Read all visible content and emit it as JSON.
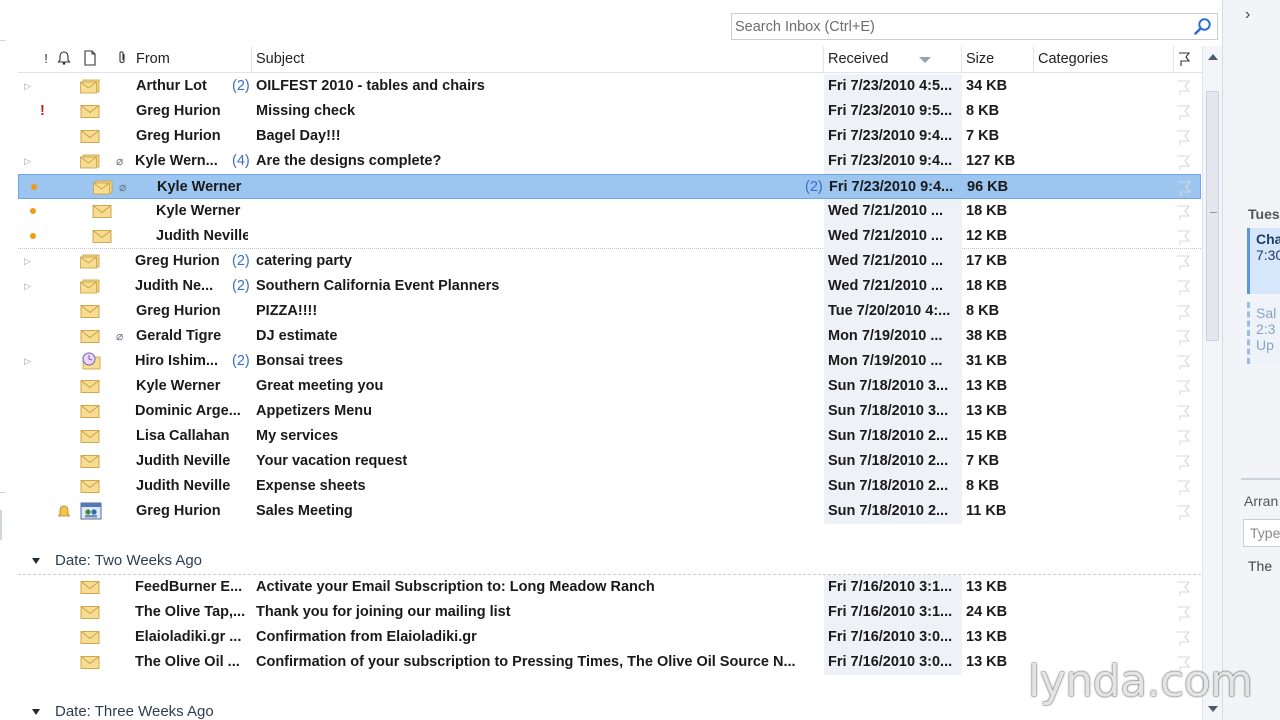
{
  "search": {
    "placeholder": "Search Inbox (Ctrl+E)"
  },
  "columns": {
    "from": "From",
    "subject": "Subject",
    "received": "Received",
    "size": "Size",
    "categories": "Categories"
  },
  "messages": [
    {
      "from": "Arthur Lot",
      "count": "(2)",
      "subject": "OILFEST 2010 - tables and chairs",
      "received": "Fri 7/23/2010 4:5...",
      "size": "34 KB"
    },
    {
      "from": "Greg Hurion",
      "subject": "Missing check",
      "received": "Fri 7/23/2010 9:5...",
      "size": "8 KB",
      "importance": "!"
    },
    {
      "from": "Greg Hurion",
      "subject": "Bagel Day!!!",
      "received": "Fri 7/23/2010 9:4...",
      "size": "7 KB"
    },
    {
      "from": "Kyle Wern...",
      "count": "(4)",
      "subject": "Are the designs complete?",
      "received": "Fri 7/23/2010 9:4...",
      "size": "127 KB"
    },
    {
      "from": "Kyle Werner",
      "count": "(2)",
      "subject": "",
      "received": "Fri 7/23/2010 9:4...",
      "size": "96 KB"
    },
    {
      "from": "Kyle Werner",
      "subject": "",
      "received": "Wed 7/21/2010 ...",
      "size": "18 KB"
    },
    {
      "from": "Judith Neville",
      "subject": "",
      "received": "Wed 7/21/2010 ...",
      "size": "12 KB"
    },
    {
      "from": "Greg Hurion",
      "count": "(2)",
      "subject": "catering party",
      "received": "Wed 7/21/2010 ...",
      "size": "17 KB"
    },
    {
      "from": "Judith Ne...",
      "count": "(2)",
      "subject": "Southern California Event Planners",
      "received": "Wed 7/21/2010 ...",
      "size": "18 KB"
    },
    {
      "from": "Greg Hurion",
      "subject": "PIZZA!!!!",
      "received": "Tue 7/20/2010 4:...",
      "size": "8 KB"
    },
    {
      "from": "Gerald Tigre",
      "subject": "DJ estimate",
      "received": "Mon 7/19/2010 ...",
      "size": "38 KB"
    },
    {
      "from": "Hiro Ishim...",
      "count": "(2)",
      "subject": "Bonsai trees",
      "received": "Mon 7/19/2010 ...",
      "size": "31 KB"
    },
    {
      "from": "Kyle Werner",
      "subject": "Great meeting you",
      "received": "Sun 7/18/2010 3...",
      "size": "13 KB"
    },
    {
      "from": "Dominic Arge...",
      "subject": "Appetizers Menu",
      "received": "Sun 7/18/2010 3...",
      "size": "13 KB"
    },
    {
      "from": "Lisa Callahan",
      "subject": "My services",
      "received": "Sun 7/18/2010 2...",
      "size": "15 KB"
    },
    {
      "from": "Judith Neville",
      "subject": "Your vacation request",
      "received": "Sun 7/18/2010 2...",
      "size": "7 KB"
    },
    {
      "from": "Judith Neville",
      "subject": "Expense sheets",
      "received": "Sun 7/18/2010 2...",
      "size": "8 KB"
    },
    {
      "from": "Greg Hurion",
      "subject": "Sales Meeting",
      "received": "Sun 7/18/2010 2...",
      "size": "11 KB"
    }
  ],
  "group_two_weeks": {
    "label": "Date: Two Weeks Ago",
    "messages": [
      {
        "from": "FeedBurner E...",
        "subject": "Activate your Email Subscription to: Long Meadow Ranch",
        "received": "Fri 7/16/2010 3:1...",
        "size": "13 KB"
      },
      {
        "from": "The Olive Tap,...",
        "subject": "Thank you for joining our mailing list",
        "received": "Fri 7/16/2010 3:1...",
        "size": "24 KB"
      },
      {
        "from": "Elaioladiki.gr ...",
        "subject": "Confirmation from Elaioladiki.gr",
        "received": "Fri 7/16/2010 3:0...",
        "size": "13 KB"
      },
      {
        "from": "The Olive Oil ...",
        "subject": "Confirmation of your subscription to Pressing Times, The Olive Oil Source N...",
        "received": "Fri 7/16/2010 3:0...",
        "size": "13 KB"
      }
    ]
  },
  "group_three_weeks": {
    "label": "Date: Three Weeks Ago"
  },
  "right_pane": {
    "day": "Tues",
    "appt_title": "Cha",
    "appt_time": "7:30",
    "appt2_line1": "Sal",
    "appt2_line2": "2:3",
    "appt2_line3": "Up",
    "arrange_label": "Arran",
    "input_placeholder": "Type",
    "note": "The"
  },
  "watermark": "lynda.com",
  "colors": {
    "selected_row": "#9cc5f0",
    "unread_dot": "#f39a12",
    "count_blue": "#3b6fc4",
    "importance_red": "#c4201a"
  }
}
